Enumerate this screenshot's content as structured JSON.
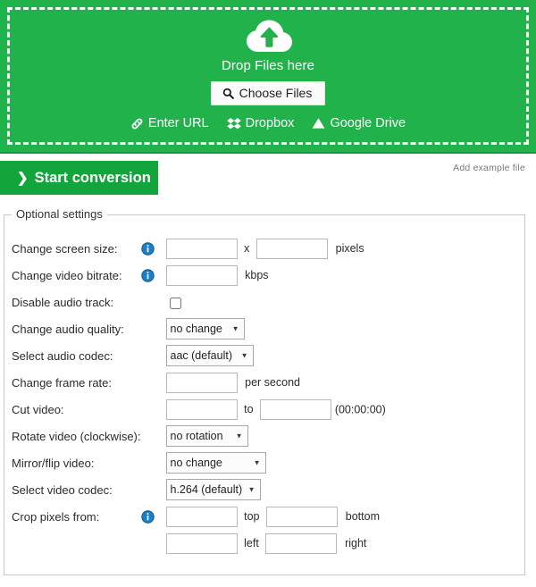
{
  "colors": {
    "brand_green": "#22b24c",
    "button_green": "#13a53c",
    "info_blue": "#1b7fc4",
    "border_gray": "#c9c9c9"
  },
  "dropzone": {
    "icon": "cloud-upload-icon",
    "drop_text": "Drop Files here",
    "choose_files_label": "Choose Files",
    "choose_files_icon": "search-icon",
    "sources": [
      {
        "label": "Enter URL",
        "icon": "link-icon"
      },
      {
        "label": "Dropbox",
        "icon": "dropbox-icon"
      },
      {
        "label": "Google Drive",
        "icon": "google-drive-icon"
      }
    ]
  },
  "action_bar": {
    "start_label": "Start conversion",
    "start_chevron": "❯",
    "add_example_label": "Add example file"
  },
  "settings": {
    "legend": "Optional settings",
    "rows": {
      "screen_size": {
        "label": "Change screen size:",
        "info": true,
        "width_value": "",
        "height_value": "",
        "separator": "x",
        "unit": "pixels"
      },
      "video_bitrate": {
        "label": "Change video bitrate:",
        "info": true,
        "value": "",
        "unit": "kbps"
      },
      "disable_audio": {
        "label": "Disable audio track:",
        "checked": false
      },
      "audio_quality": {
        "label": "Change audio quality:",
        "selected": "no change",
        "options": [
          "no change"
        ]
      },
      "audio_codec": {
        "label": "Select audio codec:",
        "selected": "aac (default)",
        "options": [
          "aac (default)"
        ]
      },
      "frame_rate": {
        "label": "Change frame rate:",
        "value": "",
        "unit": "per second"
      },
      "cut_video": {
        "label": "Cut video:",
        "from_value": "",
        "to_label": "to",
        "to_value": "",
        "hint": "(00:00:00)"
      },
      "rotate_video": {
        "label": "Rotate video (clockwise):",
        "selected": "no rotation",
        "options": [
          "no rotation"
        ]
      },
      "mirror_flip": {
        "label": "Mirror/flip video:",
        "selected": "no change",
        "options": [
          "no change"
        ]
      },
      "video_codec": {
        "label": "Select video codec:",
        "selected": "h.264 (default)",
        "options": [
          "h.264 (default)"
        ]
      },
      "crop": {
        "label": "Crop pixels from:",
        "info": true,
        "top_value": "",
        "top_label": "top",
        "bottom_value": "",
        "bottom_label": "bottom",
        "left_value": "",
        "left_label": "left",
        "right_value": "",
        "right_label": "right"
      }
    }
  }
}
